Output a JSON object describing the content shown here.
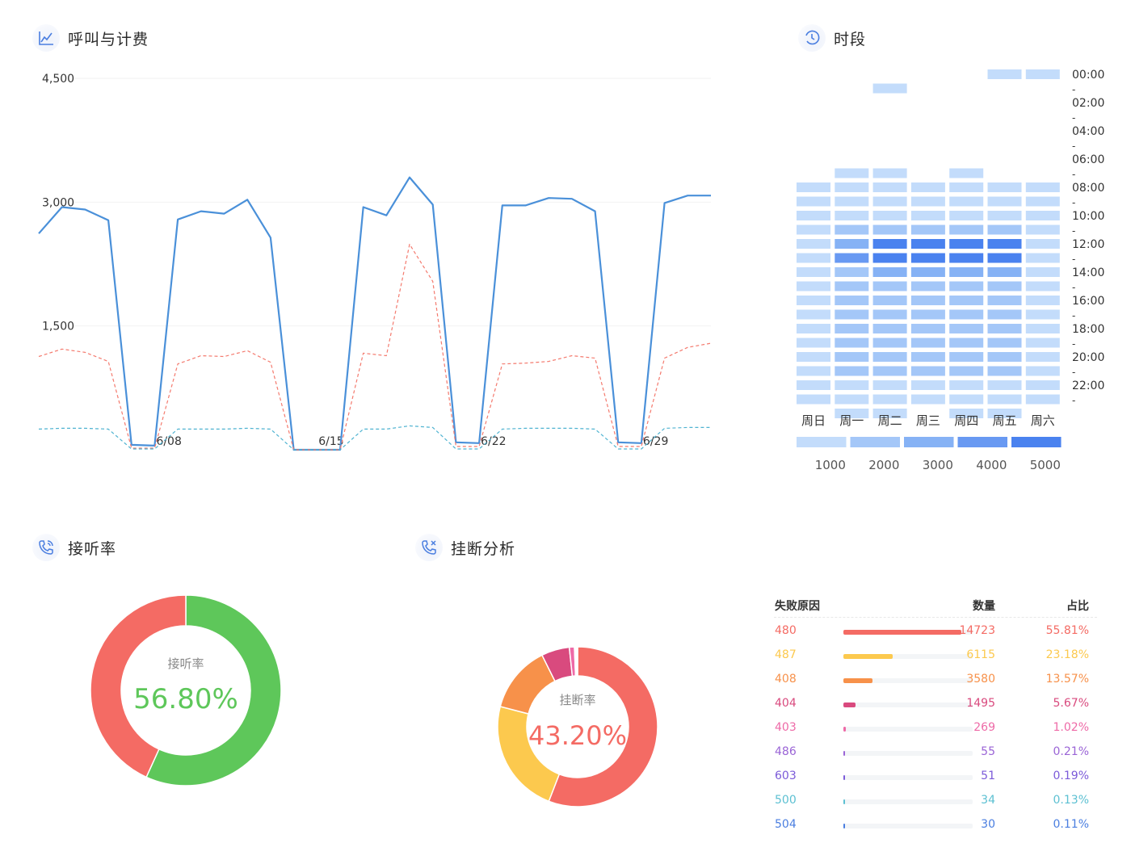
{
  "panels": {
    "calls": {
      "title": "呼叫与计费",
      "icon": "line-chart-icon"
    },
    "period": {
      "title": "时段",
      "icon": "clock-icon"
    },
    "answer": {
      "title": "接听率",
      "icon": "phone-signal-icon"
    },
    "hangup": {
      "title": "挂断分析",
      "icon": "phone-hangup-icon"
    }
  },
  "chart_data": [
    {
      "type": "line",
      "y_ticks": [
        {
          "label": "4,500",
          "value": 4500
        },
        {
          "label": "3,000",
          "value": 3000
        },
        {
          "label": "1,500",
          "value": 1500
        }
      ],
      "ylim": [
        0,
        4500
      ],
      "x_ticks": [
        {
          "label": "6/08",
          "index": 5
        },
        {
          "label": "6/15",
          "index": 12
        },
        {
          "label": "6/22",
          "index": 19
        },
        {
          "label": "6/29",
          "index": 26
        }
      ],
      "series": [
        {
          "color": "#4a90d9",
          "style": "solid",
          "values": [
            2620,
            2940,
            2910,
            2780,
            60,
            50,
            2790,
            2890,
            2860,
            3030,
            2570,
            0,
            0,
            0,
            2940,
            2840,
            3300,
            2970,
            90,
            80,
            2960,
            2960,
            3050,
            3040,
            2890,
            90,
            80,
            2990,
            3080,
            3080
          ]
        },
        {
          "color": "#f47a6e",
          "style": "dashed",
          "values": [
            1130,
            1220,
            1180,
            1070,
            20,
            20,
            1040,
            1140,
            1130,
            1200,
            1060,
            0,
            0,
            0,
            1170,
            1140,
            2490,
            2040,
            40,
            40,
            1040,
            1050,
            1070,
            1140,
            1110,
            40,
            40,
            1110,
            1240,
            1290
          ]
        },
        {
          "color": "#4fb3d1",
          "style": "dashed",
          "values": [
            250,
            260,
            260,
            250,
            10,
            10,
            250,
            250,
            250,
            260,
            250,
            0,
            0,
            0,
            250,
            250,
            290,
            270,
            10,
            10,
            250,
            260,
            260,
            260,
            250,
            10,
            10,
            260,
            270,
            270
          ]
        }
      ]
    },
    {
      "type": "heatmap",
      "days": [
        "周日",
        "周一",
        "周二",
        "周三",
        "周四",
        "周五",
        "周六"
      ],
      "hour_labels": [
        "00:00",
        "02:00",
        "04:00",
        "06:00",
        "08:00",
        "10:00",
        "12:00",
        "14:00",
        "16:00",
        "18:00",
        "20:00",
        "22:00"
      ],
      "hour_separator": "-",
      "scale_labels": [
        "1000",
        "2000",
        "3000",
        "4000",
        "5000"
      ],
      "scale_colors": [
        "#c3dcfb",
        "#a4c7f8",
        "#86b2f5",
        "#6899f2",
        "#4a82ef"
      ],
      "matrix": [
        [
          0,
          0,
          0,
          0,
          0,
          1,
          1
        ],
        [
          0,
          0,
          1,
          0,
          0,
          0,
          0
        ],
        [
          0,
          0,
          0,
          0,
          0,
          0,
          0
        ],
        [
          0,
          0,
          0,
          0,
          0,
          0,
          0
        ],
        [
          0,
          0,
          0,
          0,
          0,
          0,
          0
        ],
        [
          0,
          0,
          0,
          0,
          0,
          0,
          0
        ],
        [
          0,
          0,
          0,
          0,
          0,
          0,
          0
        ],
        [
          0,
          1,
          1,
          0,
          1,
          0,
          0
        ],
        [
          1,
          1,
          1,
          1,
          1,
          1,
          1
        ],
        [
          1,
          1,
          1,
          1,
          1,
          1,
          1
        ],
        [
          1,
          1,
          1,
          1,
          1,
          1,
          1
        ],
        [
          1,
          2,
          2,
          2,
          2,
          2,
          1
        ],
        [
          1,
          3,
          5,
          5,
          5,
          5,
          1
        ],
        [
          1,
          4,
          5,
          5,
          5,
          5,
          1
        ],
        [
          1,
          2,
          3,
          3,
          3,
          3,
          1
        ],
        [
          1,
          2,
          2,
          2,
          2,
          2,
          1
        ],
        [
          1,
          2,
          2,
          2,
          2,
          2,
          1
        ],
        [
          1,
          2,
          2,
          2,
          2,
          2,
          1
        ],
        [
          1,
          2,
          2,
          2,
          2,
          2,
          1
        ],
        [
          1,
          2,
          2,
          2,
          2,
          2,
          1
        ],
        [
          1,
          2,
          2,
          2,
          2,
          2,
          1
        ],
        [
          1,
          2,
          2,
          2,
          2,
          2,
          1
        ],
        [
          1,
          1,
          1,
          1,
          1,
          1,
          1
        ],
        [
          1,
          1,
          1,
          1,
          1,
          1,
          1
        ],
        [
          0,
          1,
          1,
          0,
          1,
          1,
          0
        ]
      ]
    },
    {
      "type": "pie",
      "center_label": "接听率",
      "center_value": "56.80%",
      "center_color": "#5ec75a",
      "slices": [
        {
          "value": 56.8,
          "color": "#5ec75a"
        },
        {
          "value": 43.2,
          "color": "#f46b64"
        }
      ]
    },
    {
      "type": "pie",
      "center_label": "挂断率",
      "center_value": "43.20%",
      "center_color": "#f46b64",
      "slices": [
        {
          "value": 55.81,
          "color": "#f46b64"
        },
        {
          "value": 23.18,
          "color": "#fcc94e"
        },
        {
          "value": 13.57,
          "color": "#f7914a"
        },
        {
          "value": 5.67,
          "color": "#d94a7e"
        },
        {
          "value": 1.02,
          "color": "#ee6aa7"
        },
        {
          "value": 0.21,
          "color": "#9a64d6"
        },
        {
          "value": 0.19,
          "color": "#7b5ad9"
        },
        {
          "value": 0.13,
          "color": "#5cc0d2"
        },
        {
          "value": 0.11,
          "color": "#4a7ee0"
        }
      ]
    },
    {
      "type": "table",
      "headers": {
        "reason": "失败原因",
        "count": "数量",
        "share": "占比"
      },
      "rows": [
        {
          "code": "480",
          "count": "14723",
          "share": "55.81%",
          "fraction": 0.5581,
          "color": "#f46b64"
        },
        {
          "code": "487",
          "count": "6115",
          "share": "23.18%",
          "fraction": 0.2318,
          "color": "#fcc94e"
        },
        {
          "code": "408",
          "count": "3580",
          "share": "13.57%",
          "fraction": 0.1357,
          "color": "#f7914a"
        },
        {
          "code": "404",
          "count": "1495",
          "share": "5.67%",
          "fraction": 0.0567,
          "color": "#d94a7e"
        },
        {
          "code": "403",
          "count": "269",
          "share": "1.02%",
          "fraction": 0.0102,
          "color": "#ee6aa7"
        },
        {
          "code": "486",
          "count": "55",
          "share": "0.21%",
          "fraction": 0.0021,
          "color": "#9a64d6"
        },
        {
          "code": "603",
          "count": "51",
          "share": "0.19%",
          "fraction": 0.0019,
          "color": "#7b5ad9"
        },
        {
          "code": "500",
          "count": "34",
          "share": "0.13%",
          "fraction": 0.0013,
          "color": "#5cc0d2"
        },
        {
          "code": "504",
          "count": "30",
          "share": "0.11%",
          "fraction": 0.0011,
          "color": "#4a7ee0"
        }
      ]
    }
  ]
}
